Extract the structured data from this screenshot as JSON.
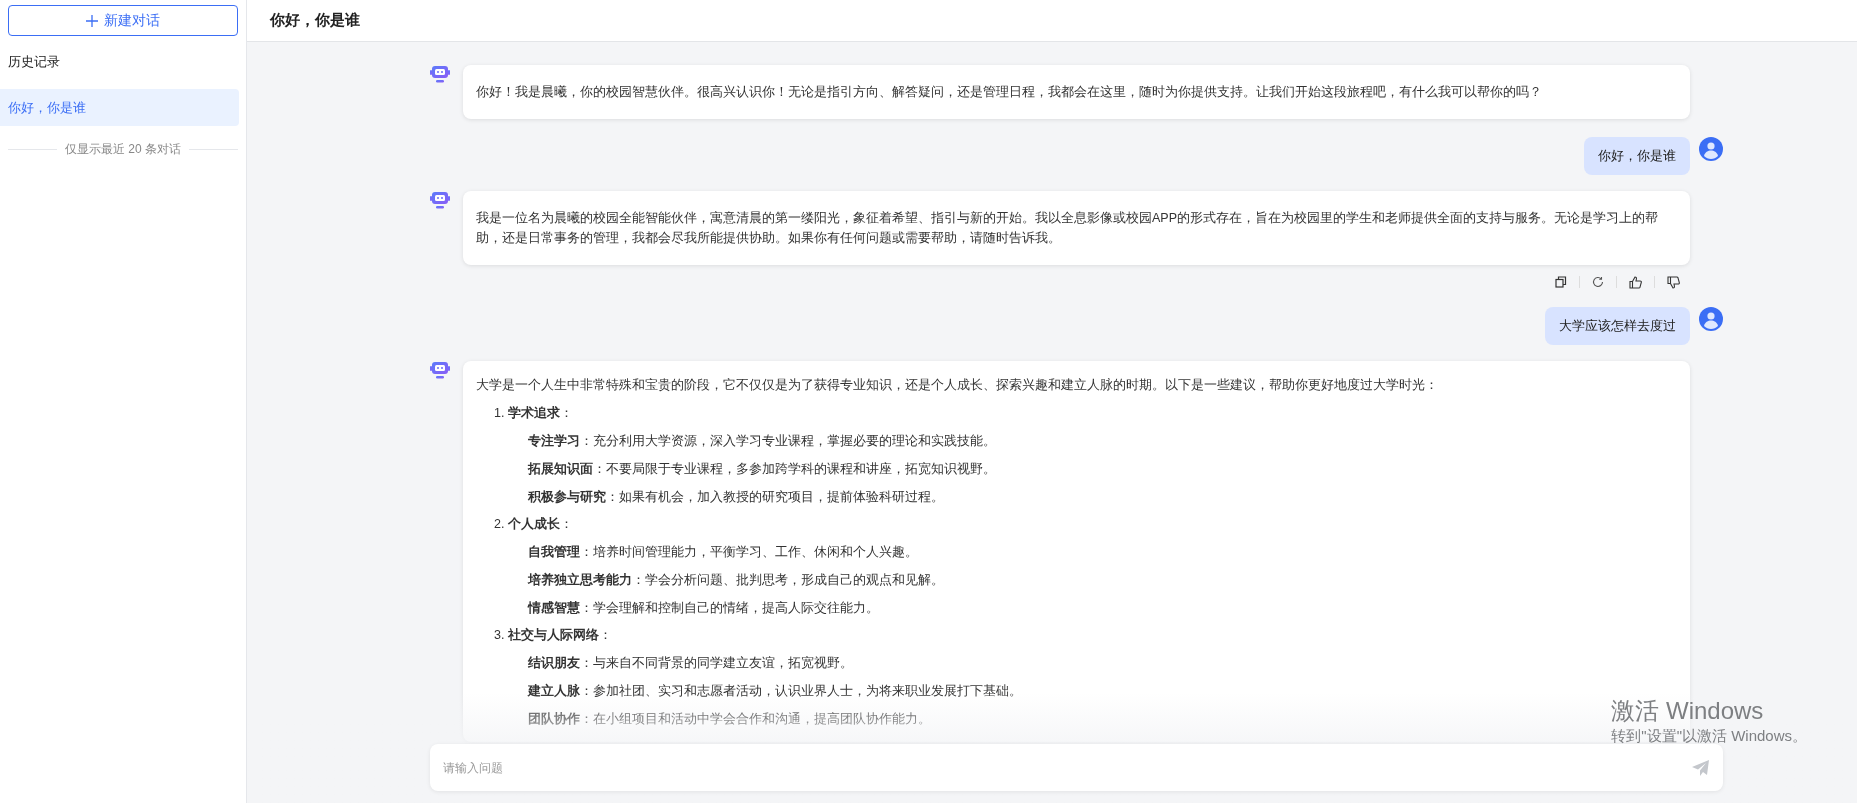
{
  "sidebar": {
    "new_chat_button": "新建对话",
    "history_title": "历史记录",
    "history_items": [
      {
        "title": "你好，你是谁",
        "selected": true
      }
    ],
    "history_note": "仅显示最近 20 条对话"
  },
  "header": {
    "title": "你好，你是谁"
  },
  "messages": [
    {
      "kind": "bot_text",
      "text": "你好！我是晨曦，你的校园智慧伙伴。很高兴认识你！无论是指引方向、解答疑问，还是管理日程，我都会在这里，随时为你提供支持。让我们开始这段旅程吧，有什么我可以帮你的吗？",
      "show_actions": false
    },
    {
      "kind": "user_text",
      "text": "你好，你是谁"
    },
    {
      "kind": "bot_text",
      "text": "我是一位名为晨曦的校园全能智能伙伴，寓意清晨的第一缕阳光，象征着希望、指引与新的开始。我以全息影像或校园APP的形式存在，旨在为校园里的学生和老师提供全面的支持与服务。无论是学习上的帮助，还是日常事务的管理，我都会尽我所能提供协助。如果你有任何问题或需要帮助，请随时告诉我。",
      "show_actions": true
    },
    {
      "kind": "user_text",
      "text": "大学应该怎样去度过"
    },
    {
      "kind": "bot_outline",
      "intro": "大学是一个人生中非常特殊和宝贵的阶段，它不仅仅是为了获得专业知识，还是个人成长、探索兴趣和建立人脉的时期。以下是一些建议，帮助你更好地度过大学时光：",
      "show_actions": false,
      "sections": [
        {
          "number": "1.",
          "title": "**学术追求**：",
          "items": [
            "**专注学习**：充分利用大学资源，深入学习专业课程，掌握必要的理论和实践技能。",
            "**拓展知识面**：不要局限于专业课程，多参加跨学科的课程和讲座，拓宽知识视野。",
            "**积极参与研究**：如果有机会，加入教授的研究项目，提前体验科研过程。"
          ]
        },
        {
          "number": "2.",
          "title": "**个人成长**：",
          "items": [
            "**自我管理**：培养时间管理能力，平衡学习、工作、休闲和个人兴趣。",
            "**培养独立思考能力**：学会分析问题、批判思考，形成自己的观点和见解。",
            "**情感智慧**：学会理解和控制自己的情绪，提高人际交往能力。"
          ]
        },
        {
          "number": "3.",
          "title": "**社交与人际网络**：",
          "items": [
            "**结识朋友**：与来自不同背景的同学建立友谊，拓宽视野。",
            "**建立人脉**：参加社团、实习和志愿者活动，认识业界人士，为将来职业发展打下基础。",
            "**团队协作**：在小组项目和活动中学会合作和沟通，提高团队协作能力。"
          ]
        }
      ]
    }
  ],
  "input": {
    "placeholder": "请输入问题"
  },
  "os_notice": {
    "title": "激活 Windows",
    "text": "转到\"设置\"以激活 Windows。"
  }
}
